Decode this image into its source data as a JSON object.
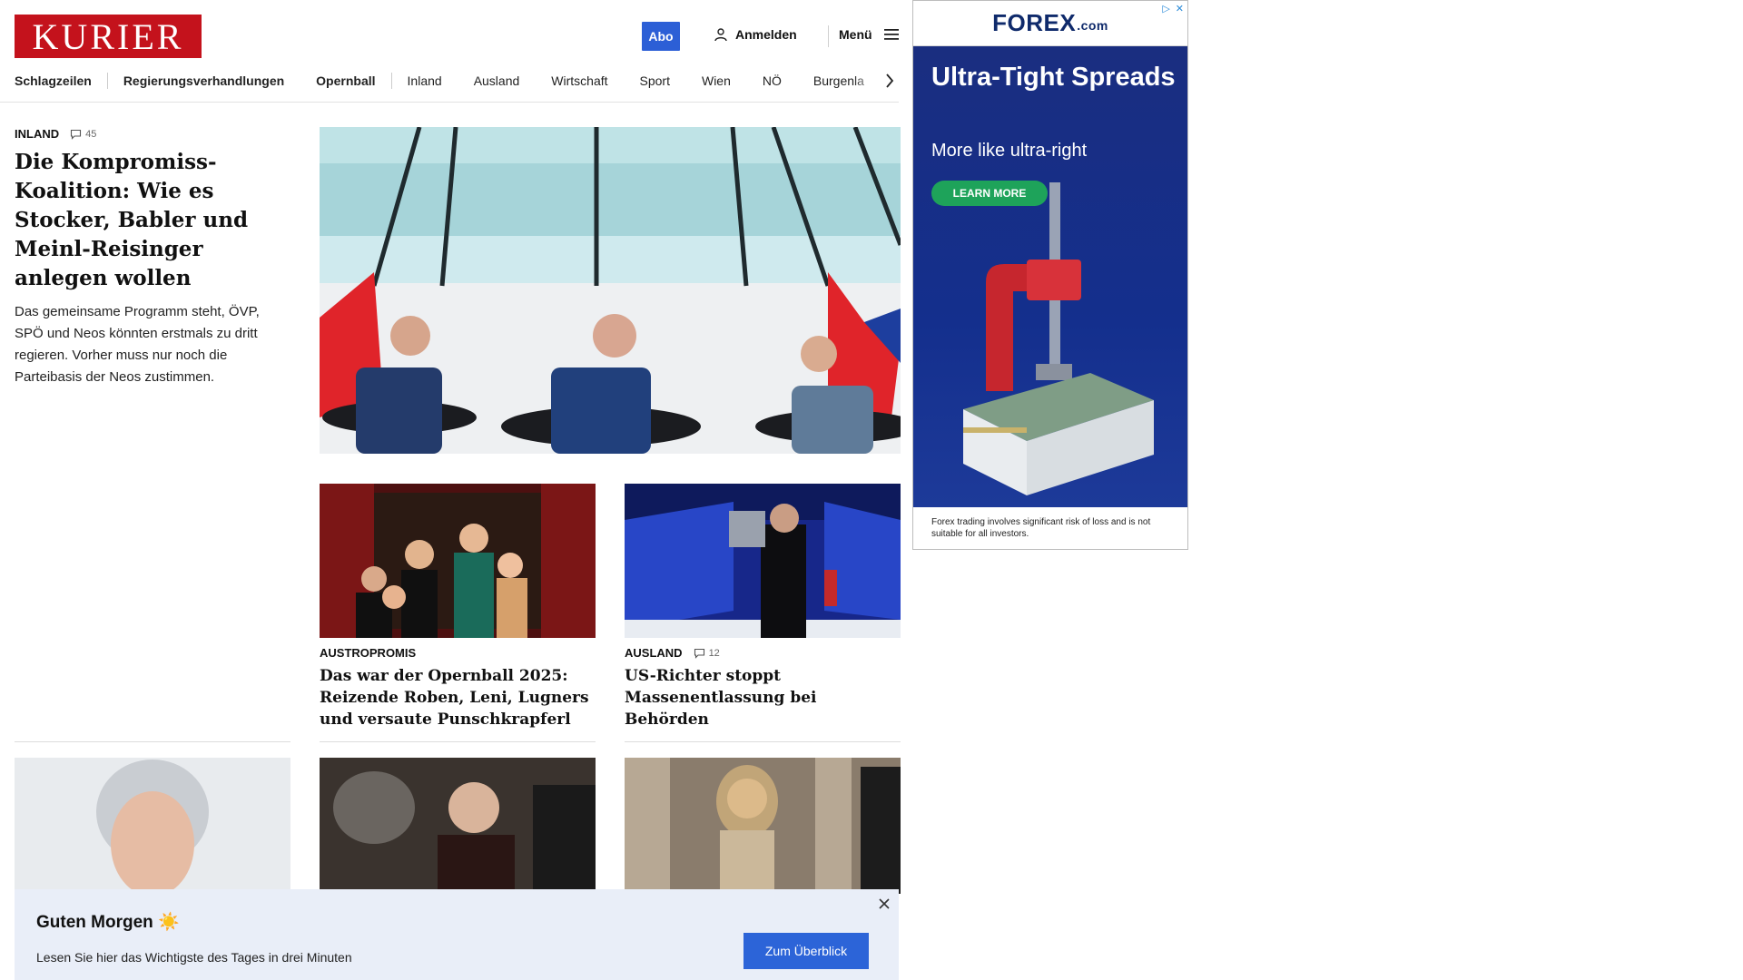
{
  "header": {
    "logo": "KURIER",
    "abo_label": "Abo",
    "login_label": "Anmelden",
    "menu_label": "Menü"
  },
  "nav": {
    "items": [
      "Schlagzeilen",
      "Regierungsverhandlungen",
      "Opernball",
      "Inland",
      "Ausland",
      "Wirtschaft",
      "Sport",
      "Wien",
      "NÖ",
      "Burgenla"
    ]
  },
  "lead": {
    "category": "INLAND",
    "comments": "45",
    "title": "Die Kompromiss-Koalition: Wie es Stocker, Babler und Meinl-Reisinger anlegen wollen",
    "teaser": "Das gemeinsame Programm steht, ÖVP, SPÖ und Neos könnten erstmals zu dritt regieren. Vorher muss nur noch die Parteibasis der Neos zustimmen."
  },
  "cards": [
    {
      "category": "AUSTROPROMIS",
      "title": "Das war der Opernball 2025: Reizende Roben, Leni, Lugners und versaute Punschkrapferl"
    },
    {
      "category": "AUSLAND",
      "comments": "12",
      "title": "US-Richter stoppt Massenentlassung bei Behörden"
    }
  ],
  "ad": {
    "brand": "FOREX",
    "brand_suffix": ".com",
    "headline": "Ultra-Tight Spreads",
    "subline": "More like ultra-right",
    "cta": "LEARN MORE",
    "disclaimer": "Forex trading involves significant risk of loss and is not suitable for all investors."
  },
  "briefing": {
    "title": "Guten Morgen ☀️",
    "subtitle": "Lesen Sie hier das Wichtigste des Tages in drei Minuten",
    "button": "Zum Überblick"
  },
  "colors": {
    "brand_red": "#c4121c",
    "accent_blue": "#2c5fd6",
    "ad_navy": "#1a2e80",
    "ad_green": "#1ea35a",
    "briefing_bg": "#e9eef8"
  }
}
